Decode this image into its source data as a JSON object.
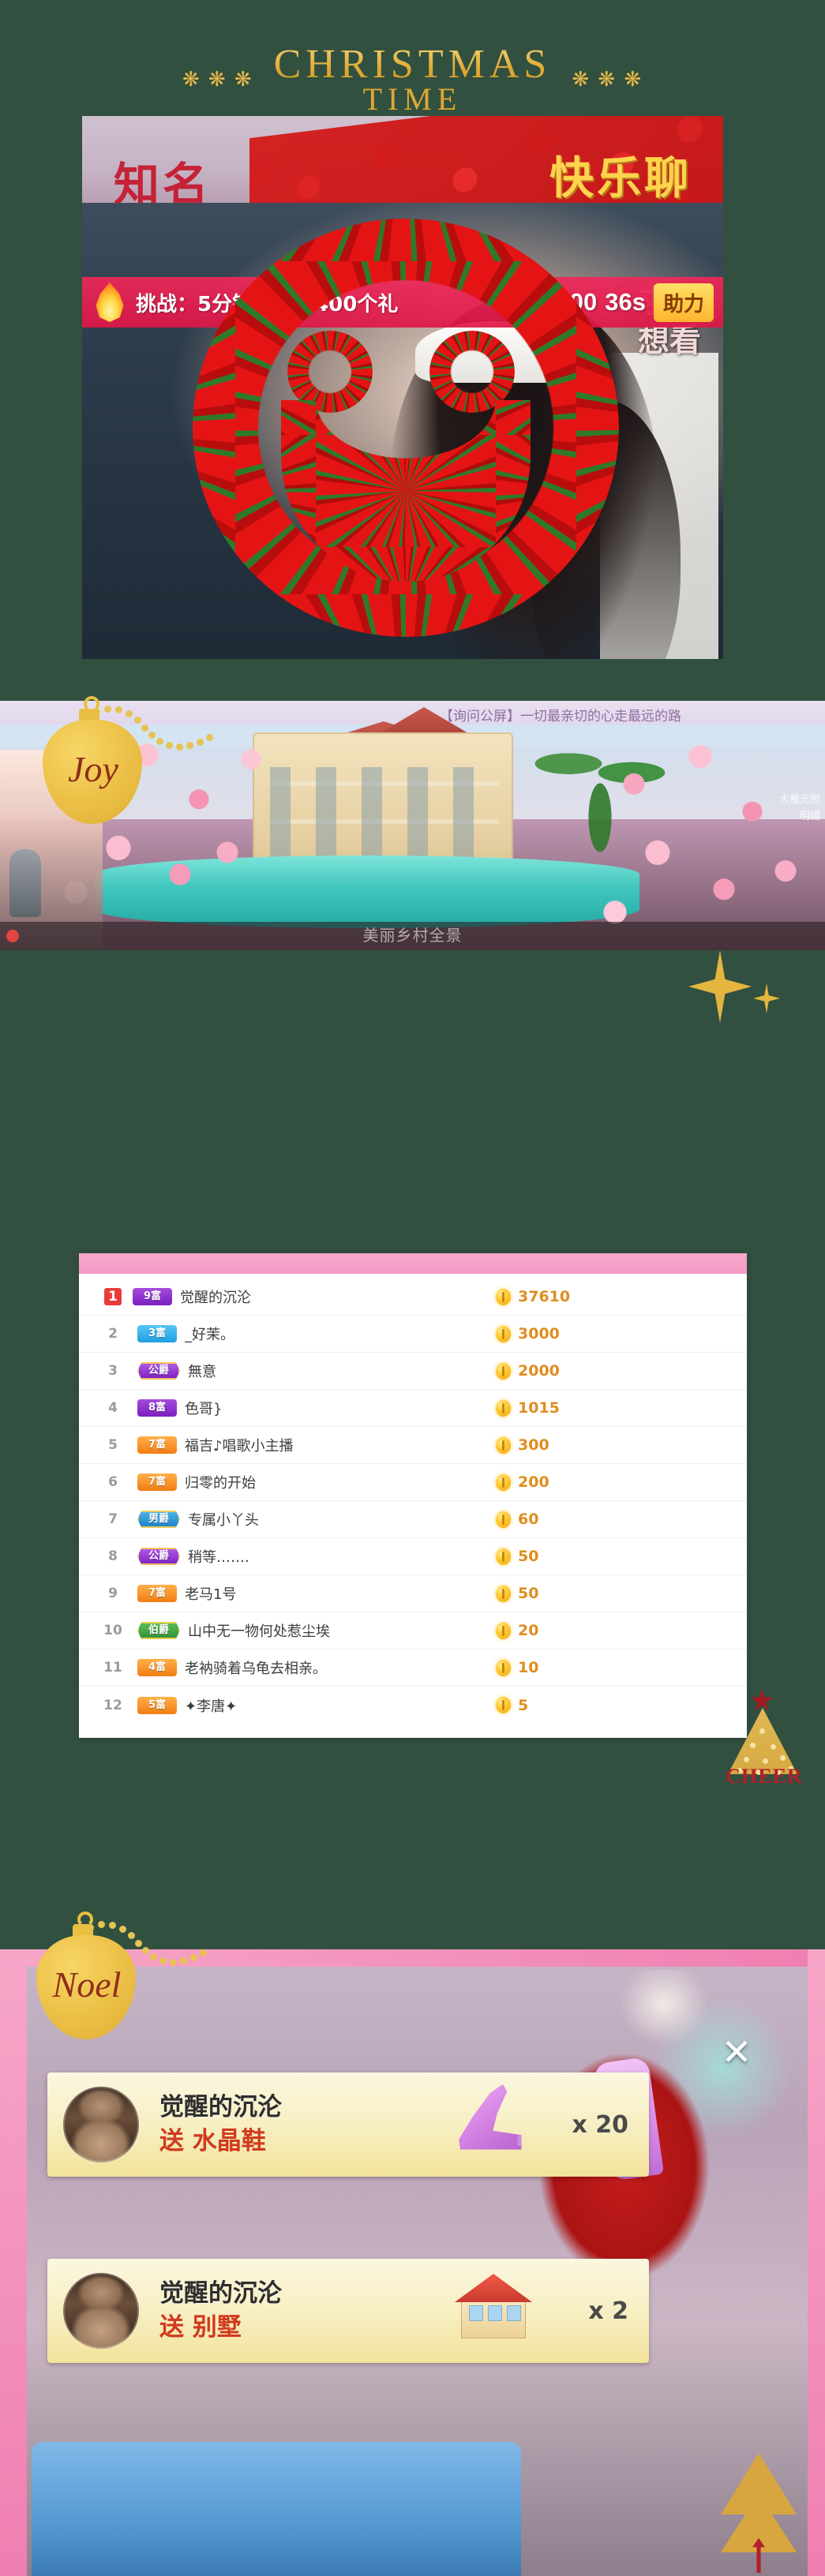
{
  "header": {
    "snowflake_left": "❋ ❋ ❋",
    "snowflake_right": "❋ ❋ ❋",
    "title": "CHRISTMAS",
    "subtitle": "TIME"
  },
  "panel_live": {
    "overlay_title_cn": "知名",
    "overlay_title_gold": "快乐聊",
    "right_caption": "求这\n想看",
    "banner": {
      "task_text": "挑战：5分钟内收到400个礼",
      "progress": "200/400",
      "timer": "36s",
      "help_button": "助力",
      "flame_icon": "flame-icon"
    },
    "overlay_graphic": "red-rose-smiley-overlay"
  },
  "ornaments": {
    "joy": "Joy",
    "noel": "Noel",
    "cheer": "CHEER"
  },
  "panel_villa": {
    "chat_line_1": "【询问公屏】一切最亲切的心走最远的路",
    "side_note_1": "大雁光照",
    "side_note_2": "明媚",
    "bottom_caption": "美丽乡村全景"
  },
  "ranking": {
    "rows": [
      {
        "rank": "1",
        "badge": "9富",
        "badge_style": "purple",
        "name": "觉醒的沉沦",
        "coins": "37610"
      },
      {
        "rank": "2",
        "badge": "3富",
        "badge_style": "blue",
        "name": "_好茉。",
        "coins": "3000"
      },
      {
        "rank": "3",
        "badge": "公爵",
        "badge_style": "hex-purple",
        "name": "無意",
        "coins": "2000"
      },
      {
        "rank": "4",
        "badge": "8富",
        "badge_style": "purple",
        "name": "色哥}",
        "coins": "1015"
      },
      {
        "rank": "5",
        "badge": "7富",
        "badge_style": "orange",
        "name": "福吉♪唱歌小主播",
        "coins": "300"
      },
      {
        "rank": "6",
        "badge": "7富",
        "badge_style": "orange",
        "name": "归零的开始",
        "coins": "200"
      },
      {
        "rank": "7",
        "badge": "男爵",
        "badge_style": "hex-blue",
        "name": "专属小丫头",
        "coins": "60"
      },
      {
        "rank": "8",
        "badge": "公爵",
        "badge_style": "hex-purple",
        "name": "稍等…….",
        "coins": "50"
      },
      {
        "rank": "9",
        "badge": "7富",
        "badge_style": "orange",
        "name": "老马1号",
        "coins": "50"
      },
      {
        "rank": "10",
        "badge": "伯爵",
        "badge_style": "hex-green",
        "name": "山中无一物何处惹尘埃",
        "coins": "20"
      },
      {
        "rank": "11",
        "badge": "4富",
        "badge_style": "orange",
        "name": "老衲骑着乌龟去相亲。",
        "coins": "10"
      },
      {
        "rank": "12",
        "badge": "5富",
        "badge_style": "orange",
        "name": "✦李唐✦",
        "coins": "5"
      }
    ]
  },
  "gifts": {
    "close_label": "✕",
    "items": [
      {
        "user": "觉醒的沉沦",
        "action": "送 水晶鞋",
        "qty": "x 20",
        "icon": "crystal-shoe-icon",
        "avatar": "user-avatar"
      },
      {
        "user": "觉醒的沉沦",
        "action": "送 别墅",
        "qty": "x 2",
        "icon": "villa-house-icon",
        "avatar": "user-avatar"
      }
    ]
  },
  "colors": {
    "background": "#32503f",
    "gold": "#e0a832",
    "pink_header": "#f49ac6",
    "coin_orange": "#e08d1e",
    "banner_red": "#e01646",
    "gift_card": "#f7eec0",
    "gift_action_red": "#d03a1e"
  }
}
